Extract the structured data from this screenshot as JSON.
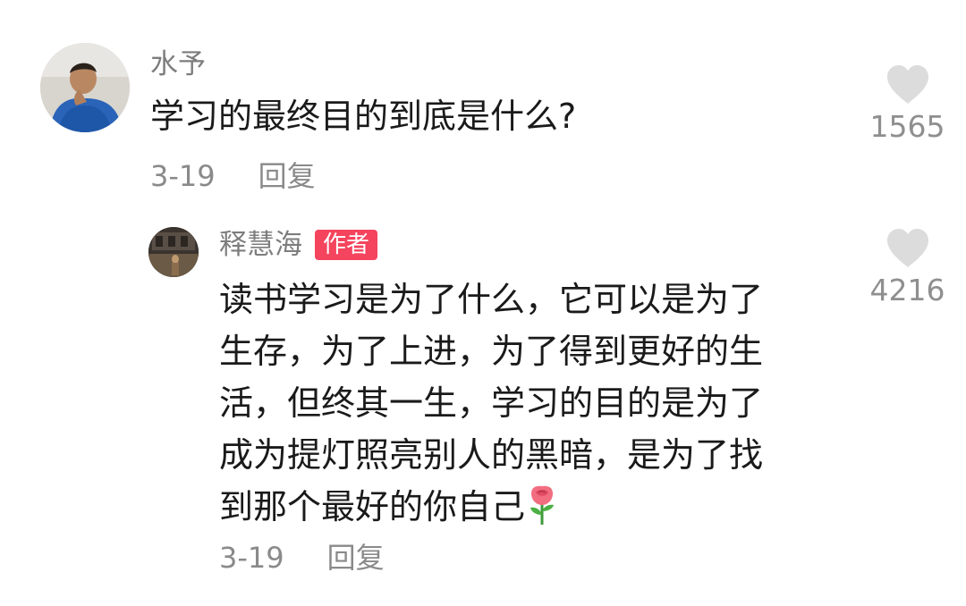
{
  "comment": {
    "username": "水予",
    "text": "学习的最终目的到底是什么?",
    "date": "3-19",
    "reply_label": "回复",
    "likes": "1565",
    "avatar": "user-avatar-photo",
    "like_icon": "heart-icon"
  },
  "reply": {
    "username": "释慧海",
    "author_badge": "作者",
    "text_lines": [
      "读书学习是为了什么，它可以是为了",
      "生存，为了上进，为了得到更好的生",
      "活，但终其一生，学习的目的是为了",
      "成为提灯照亮别人的黑暗，是为了找",
      "到那个最好的你自己"
    ],
    "emoji": "rose-icon",
    "date": "3-19",
    "reply_label": "回复",
    "likes": "4216",
    "avatar": "author-avatar-photo",
    "like_icon": "heart-icon"
  },
  "colors": {
    "badge_bg": "#f5445e",
    "meta_text": "#8a8a8a",
    "heart": "#dcdcdc"
  }
}
